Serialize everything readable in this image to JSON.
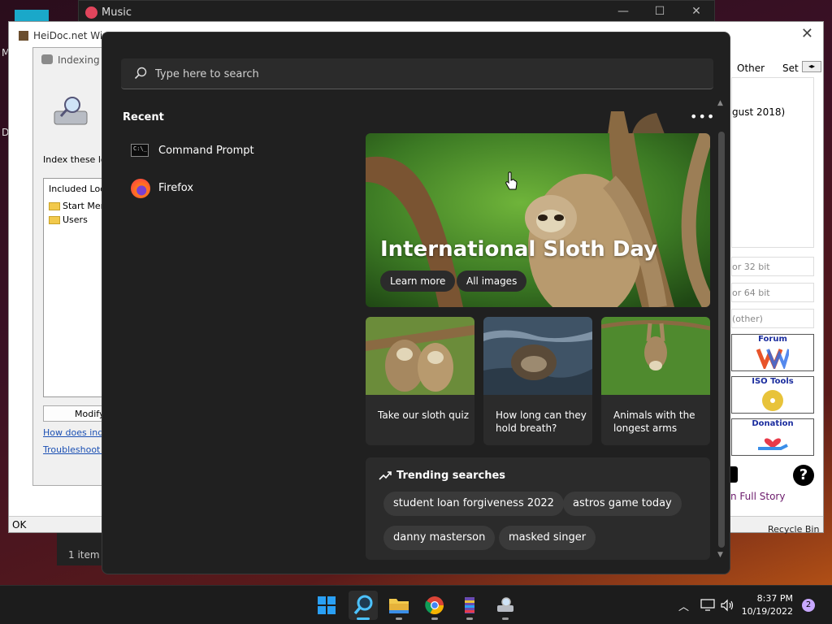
{
  "background_windows": {
    "music": {
      "title": "Music"
    },
    "heidoc": {
      "title": "HeiDoc.net Win",
      "tabs": [
        "Other",
        "Set"
      ],
      "date_fragment": "gust 2018)",
      "fields": [
        "or 32 bit",
        "or 64 bit",
        "(other)"
      ],
      "promos": [
        "Forum",
        "ISO Tools",
        "Donation"
      ],
      "full_story": "n Full Story",
      "status": "OK",
      "recycle": "Recycle Bin"
    },
    "indexing": {
      "title": "Indexing O",
      "index_label": "Index these loc",
      "list_header": "Included Loca",
      "locations": [
        "Start Menu",
        "Users"
      ],
      "modify_button": "Modify",
      "links": [
        "How does index",
        "Troubleshoot s"
      ]
    },
    "explorer_status": "1 item"
  },
  "search": {
    "placeholder": "Type here to search",
    "recent_heading": "Recent",
    "recent": [
      {
        "label": "Command Prompt",
        "icon": "command-prompt-icon"
      },
      {
        "label": "Firefox",
        "icon": "firefox-icon"
      }
    ],
    "hero": {
      "title": "International Sloth Day",
      "learn_more": "Learn more",
      "all_images": "All images"
    },
    "cards": [
      {
        "caption": "Take our sloth quiz"
      },
      {
        "caption": "How long can they hold breath?"
      },
      {
        "caption": "Animals with the longest arms"
      }
    ],
    "trending": {
      "heading": "Trending searches",
      "items": [
        "student loan forgiveness 2022",
        "astros game today",
        "danny masterson",
        "masked singer"
      ]
    }
  },
  "taskbar": {
    "time": "8:37 PM",
    "date": "10/19/2022",
    "notifications": "2",
    "apps": [
      "start",
      "search",
      "file-explorer",
      "chrome",
      "winrar",
      "network"
    ]
  }
}
